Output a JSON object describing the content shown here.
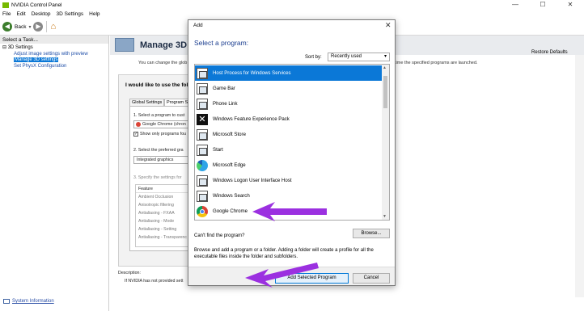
{
  "window": {
    "title": "NVIDIA Control Panel",
    "controls": [
      "—",
      "☐",
      "✕"
    ]
  },
  "menubar": [
    "File",
    "Edit",
    "Desktop",
    "3D Settings",
    "Help"
  ],
  "toolbar": {
    "back_label": "Back"
  },
  "sidebar": {
    "header": "Select a Task...",
    "root": "3D Settings",
    "items": [
      "Adjust image settings with preview",
      "Manage 3D settings",
      "Set PhysX Configuration"
    ],
    "system_info": "System Information"
  },
  "main": {
    "title": "Manage 3D",
    "restore": "Restore Defaults",
    "desc_left": "You can change the glob",
    "desc_right": "time the specified programs are launched.",
    "panel_title": "I would like to use the follo",
    "tabs": [
      "Global Settings",
      "Program Se"
    ],
    "step1": "1. Select a program to cust",
    "program_value": "Google Chrome (chron",
    "show_only": "Show only programs fou",
    "step2": "2. Select the preferred gra",
    "graphics_value": "Integrated graphics",
    "step3": "3. Specify the settings for",
    "feature_header": "Feature",
    "features": [
      "Ambient Occlusion",
      "Anisotropic filtering",
      "Antialiasing - FXAA",
      "Antialiasing - Mode",
      "Antialiasing - Setting",
      "Antialiasing - Transparenc"
    ],
    "description_label": "Description:",
    "description_body": "If NVIDIA has not provided sett"
  },
  "dialog": {
    "title": "Add",
    "close": "✕",
    "select_label": "Select a program:",
    "sort_label": "Sort by:",
    "sort_value": "Recently used",
    "programs": [
      {
        "label": "Host Process for Windows Services",
        "icon": "app-window-icon"
      },
      {
        "label": "Game Bar",
        "icon": "app-window-icon"
      },
      {
        "label": "Phone Link",
        "icon": "app-window-icon"
      },
      {
        "label": "Windows Feature Experience Pack",
        "icon": "feature-pack-icon"
      },
      {
        "label": "Microsoft Store",
        "icon": "app-window-icon"
      },
      {
        "label": "Start",
        "icon": "app-window-icon"
      },
      {
        "label": "Microsoft Edge",
        "icon": "edge-icon"
      },
      {
        "label": "Windows Logon User Interface Host",
        "icon": "app-window-icon"
      },
      {
        "label": "Windows Search",
        "icon": "app-window-icon"
      },
      {
        "label": "Google Chrome",
        "icon": "chrome-icon"
      }
    ],
    "cant_find": "Can't find the program?",
    "browse": "Browse...",
    "browse_desc": "Browse and add a program or a folder. Adding a folder will create a profile for all the executable files inside the folder and subfolders.",
    "add_selected": "Add Selected Program",
    "cancel": "Cancel"
  },
  "colors": {
    "selection": "#0b78d7",
    "annotation_arrow": "#9b30e0",
    "nvidia_green": "#76b900"
  }
}
